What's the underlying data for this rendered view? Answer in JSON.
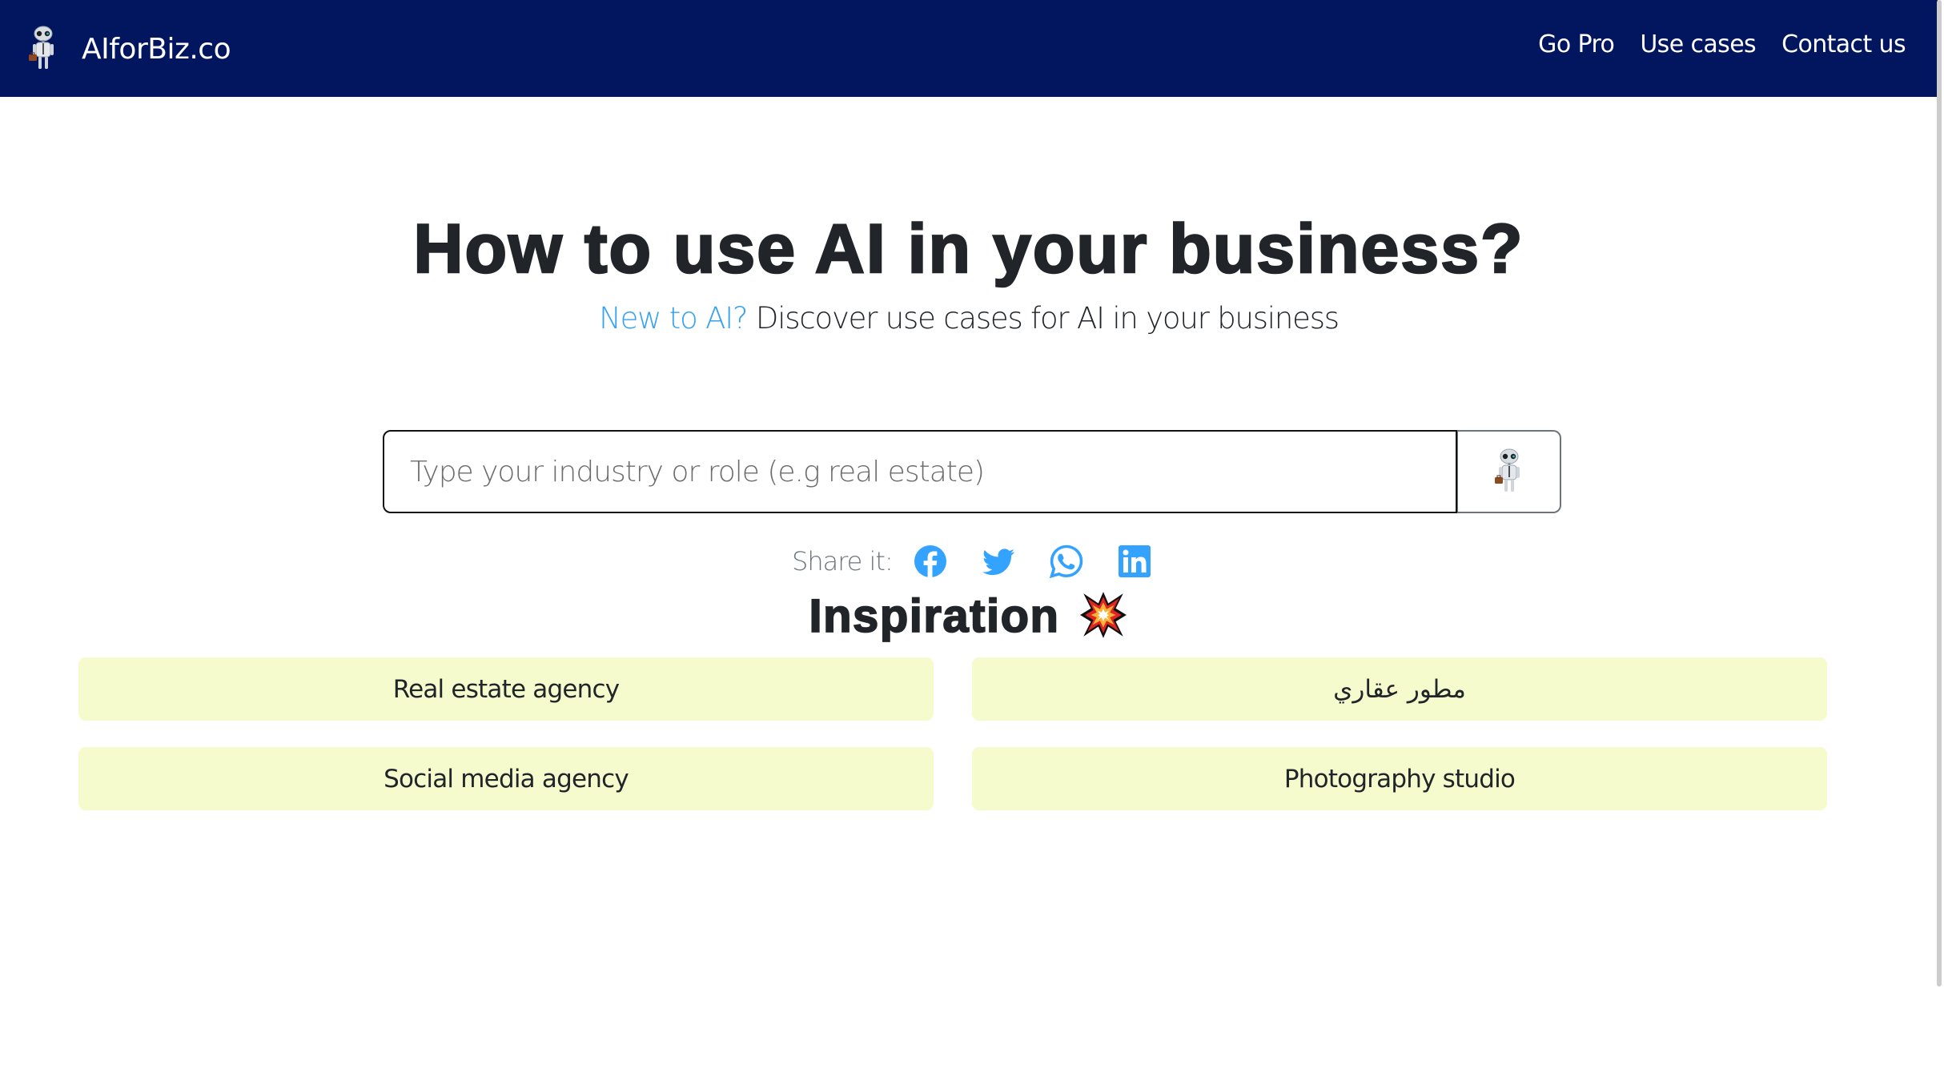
{
  "header": {
    "brand": "AIforBiz.co",
    "logo_icon": "robot-with-briefcase",
    "nav": [
      {
        "label": "Go Pro"
      },
      {
        "label": "Use cases"
      },
      {
        "label": "Contact us"
      }
    ],
    "background_color": "#021660"
  },
  "hero": {
    "title": "How to use AI in your business?",
    "subtitle_accent": "New to AI?",
    "subtitle_rest": " Discover use cases for AI in your business",
    "accent_color": "#36a2f0"
  },
  "search": {
    "value": "",
    "placeholder": "Type your industry or role (e.g real estate)",
    "button_icon": "robot-with-briefcase"
  },
  "share": {
    "label": "Share it:",
    "icons": [
      "facebook-icon",
      "twitter-icon",
      "whatsapp-icon",
      "linkedin-icon"
    ],
    "icon_color": "#33a3ff"
  },
  "inspiration": {
    "title": "Inspiration",
    "emoji": "collision",
    "cards": [
      {
        "label": "Real estate agency"
      },
      {
        "label": "مطور عقاري"
      },
      {
        "label": "Social media agency"
      },
      {
        "label": "Photography studio"
      }
    ],
    "card_color": "#f5fbcd"
  }
}
